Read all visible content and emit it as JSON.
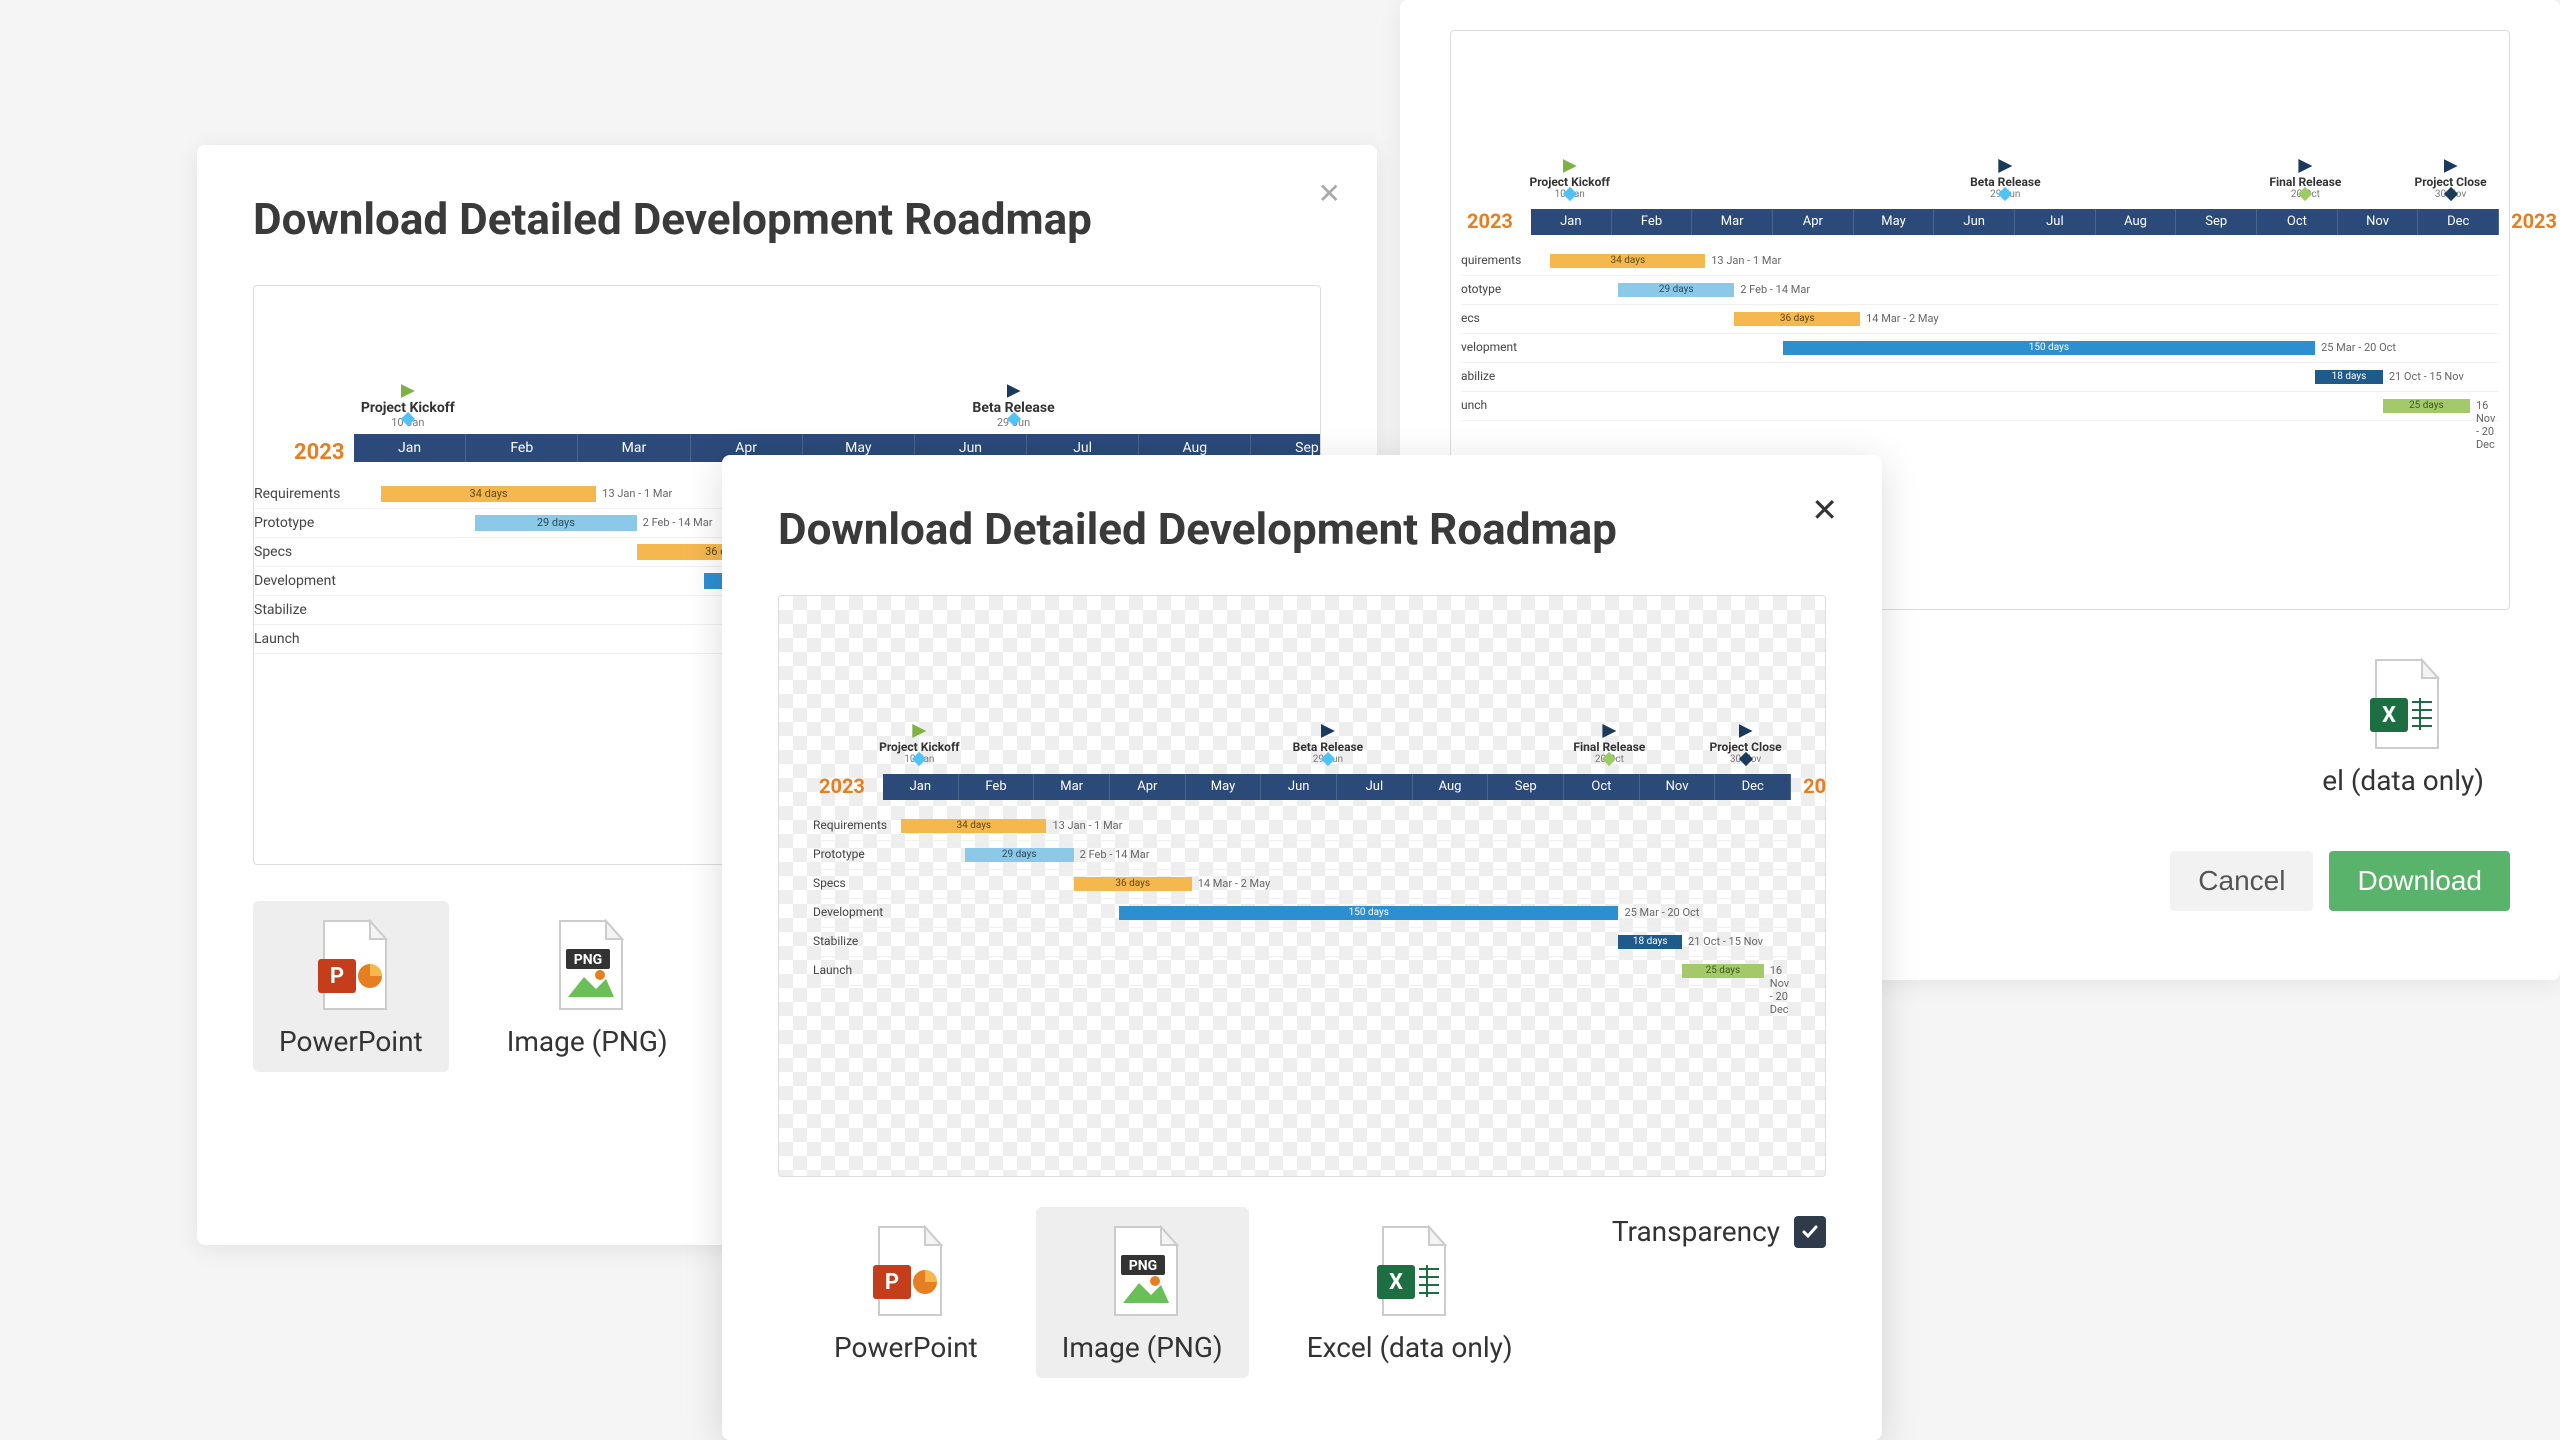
{
  "dialog_title": "Download Detailed Development Roadmap",
  "close_glyph": "✕",
  "formats": {
    "powerpoint": "PowerPoint",
    "image_png": "Image (PNG)",
    "excel": "Excel (data only)",
    "excel_partial": "el (data only)"
  },
  "transparency_label": "Transparency",
  "buttons": {
    "cancel": "Cancel",
    "download": "Download"
  },
  "timeline": {
    "year": "2023",
    "months": [
      "Jan",
      "Feb",
      "Mar",
      "Apr",
      "May",
      "Jun",
      "Jul",
      "Aug",
      "Sep",
      "Oct",
      "Nov",
      "Dec"
    ],
    "milestones": [
      {
        "name": "Project Kickoff",
        "date": "10 Jan",
        "flag": "green",
        "diamond": "blue",
        "pos_pct": 4
      },
      {
        "name": "Beta Release",
        "date": "29 Jun",
        "flag": "navy",
        "diamond": "blue",
        "pos_pct": 49
      },
      {
        "name": "Final Release",
        "date": "20 Oct",
        "flag": "navy",
        "diamond": "green",
        "pos_pct": 80
      },
      {
        "name": "Project Close",
        "date": "30 Nov",
        "flag": "navy",
        "diamond": "navy",
        "pos_pct": 95
      }
    ],
    "rows": [
      {
        "label": "Requirements",
        "color": "orange",
        "text": "34 days",
        "start_pct": 2,
        "end_pct": 18,
        "range": "13 Jan - 1 Mar"
      },
      {
        "label": "Prototype",
        "color": "ltblue",
        "text": "29 days",
        "start_pct": 9,
        "end_pct": 21,
        "range": "2 Feb - 14 Mar"
      },
      {
        "label": "Specs",
        "color": "orange",
        "text": "36 days",
        "start_pct": 21,
        "end_pct": 34,
        "range": "14 Mar - 2 May"
      },
      {
        "label": "Development",
        "color": "blue",
        "text": "150 days",
        "start_pct": 26,
        "end_pct": 81,
        "range": "25 Mar - 20 Oct"
      },
      {
        "label": "Stabilize",
        "color": "navy",
        "text": "18 days",
        "start_pct": 81,
        "end_pct": 88,
        "range": "21 Oct - 15 Nov"
      },
      {
        "label": "Launch",
        "color": "green",
        "text": "25 days",
        "start_pct": 88,
        "end_pct": 97,
        "range": "16 Nov - 20 Dec"
      }
    ]
  },
  "timeline_bg": {
    "rows": [
      {
        "label": "quirements",
        "color": "orange",
        "text": "34 days",
        "start_pct": 2,
        "end_pct": 18,
        "range": "13 Jan - 1 Mar"
      },
      {
        "label": "ototype",
        "color": "ltblue",
        "text": "29 days",
        "start_pct": 9,
        "end_pct": 21,
        "range": "2 Feb - 14 Mar"
      },
      {
        "label": "ecs",
        "color": "orange",
        "text": "36 days",
        "start_pct": 21,
        "end_pct": 34,
        "range": "14 Mar - 2 May"
      },
      {
        "label": "velopment",
        "color": "blue",
        "text": "150 days",
        "start_pct": 26,
        "end_pct": 81,
        "range": "25 Mar - 20 Oct"
      },
      {
        "label": "abilize",
        "color": "navy",
        "text": "18 days",
        "start_pct": 81,
        "end_pct": 88,
        "range": "21 Oct - 15 Nov"
      },
      {
        "label": "unch",
        "color": "green",
        "text": "25 days",
        "start_pct": 88,
        "end_pct": 97,
        "range": "16 Nov - 20 Dec"
      }
    ]
  }
}
